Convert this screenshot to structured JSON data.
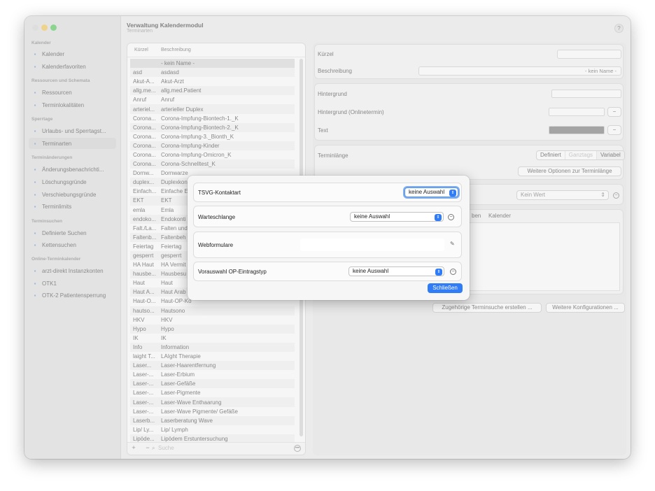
{
  "header": {
    "title": "Verwaltung Kalendermodul",
    "subtitle": "Terminarten",
    "help": "?"
  },
  "sidebar": {
    "sections": [
      {
        "title": "Kalender",
        "items": [
          "Kalender",
          "Kalenderfavoriten"
        ]
      },
      {
        "title": "Ressourcen und Schemata",
        "items": [
          "Ressourcen",
          "Terminlokalitäten"
        ]
      },
      {
        "title": "Sperrtage",
        "items": [
          "Urlaubs- und Sperrtagst...",
          "Terminarten"
        ]
      },
      {
        "title": "Terminänderungen",
        "items": [
          "Änderungsbenachrichti...",
          "Löschungsgründe",
          "Verschiebungsgründe",
          "Terminlimits"
        ]
      },
      {
        "title": "Terminsuchen",
        "items": [
          "Definierte Suchen",
          "Kettensuchen"
        ]
      },
      {
        "title": "Online-Terminkalender",
        "items": [
          "arzt-direkt Instanzkonten",
          "OTK1",
          "OTK-2 Patientensperrung"
        ]
      }
    ],
    "selected": "Terminarten"
  },
  "list": {
    "headers": {
      "kuerzel": "Kürzel",
      "beschreibung": "Beschreibung"
    },
    "rows": [
      [
        "",
        "- kein Name -"
      ],
      [
        "asd",
        "asdasd"
      ],
      [
        "Akut-A...",
        "Akut-Arzt"
      ],
      [
        "allg.me...",
        "allg.med.Patient"
      ],
      [
        "Anruf",
        "Anruf"
      ],
      [
        "arteriel...",
        "arterieller Duplex"
      ],
      [
        "Corona...",
        "Corona-Impfung-Biontech-1._K"
      ],
      [
        "Corona...",
        "Corona-Impfung-Biontech-2._K"
      ],
      [
        "Corona...",
        "Corona-Impfung-3._Bionth_K"
      ],
      [
        "Corona...",
        "Corona-Impfung-Kinder"
      ],
      [
        "Corona...",
        "Corona-Impfung-Omicron_K"
      ],
      [
        "Corona...",
        "Corona-Schnelltest_K"
      ],
      [
        "Dornw...",
        "Dornwarze"
      ],
      [
        "duplex...",
        "Duplexkon"
      ],
      [
        "Einfach...",
        "Einfache E"
      ],
      [
        "EKT",
        "EKT"
      ],
      [
        "emla",
        "Emla"
      ],
      [
        "endoko...",
        "Endokonti"
      ],
      [
        "Falt./La...",
        "Falten und"
      ],
      [
        "Faltenb...",
        "Faltenbeh"
      ],
      [
        "Feiertag",
        "Feiertag"
      ],
      [
        "gesperrt",
        "gesperrt"
      ],
      [
        "HA Haut",
        "HA Vermit"
      ],
      [
        "hausbe...",
        "Hausbesu"
      ],
      [
        "Haut",
        "Haut"
      ],
      [
        "Haut A...",
        "Haut Arab"
      ],
      [
        "Haut-O...",
        "Haut-OP-Ko"
      ],
      [
        "hautso...",
        "Hautsono"
      ],
      [
        "HKV",
        "HKV"
      ],
      [
        "Hypo",
        "Hypo"
      ],
      [
        "IK",
        "IK"
      ],
      [
        "Info",
        "Information"
      ],
      [
        "laight T...",
        "LAIght Therapie"
      ],
      [
        "Laser...",
        "Laser-Haarentfernung"
      ],
      [
        "Laser-...",
        "Laser-Erbium"
      ],
      [
        "Laser-...",
        "Laser-Gefäße"
      ],
      [
        "Laser-...",
        "Laser-Pigmente"
      ],
      [
        "Laser-...",
        "Laser-Wave Enthaarung"
      ],
      [
        "Laser-...",
        "Laser-Wave Pigmente/ Gefäße"
      ],
      [
        "Laserb...",
        "Laserberatung Wave"
      ],
      [
        "Lip/ Ly...",
        "Lip/ Lymph"
      ],
      [
        "Lipöde...",
        "Lipödem Erstuntersuchung"
      ]
    ],
    "footer": {
      "plus": "+",
      "minus": "−",
      "search_placeholder": "Suche"
    }
  },
  "detail": {
    "kuerzel_label": "Kürzel",
    "beschreibung_label": "Beschreibung",
    "beschreibung_value": "- kein Name -",
    "hintergrund_label": "Hintergrund",
    "hintergrund_online_label": "Hintergrund (Onlinetermin)",
    "text_label": "Text",
    "minus": "−",
    "terminlaenge_label": "Terminlänge",
    "terminlaenge_options": [
      "Definiert",
      "Ganztags",
      "Variabel"
    ],
    "weitere_optionen": "Weitere Optionen zur Terminlänge",
    "kein_wert": "Kein Wert",
    "tabs_partial": "ben",
    "tab_kalender": "Kalender",
    "btn_terminsuche": "Zugehörige Terminsuche erstellen ...",
    "btn_weitere_konfig": "Weitere Konfigurationen ..."
  },
  "modal": {
    "tsvg_label": "TSVG-Kontaktart",
    "tsvg_value": "keine Auswahl",
    "warteschlange_label": "Warteschlange",
    "warteschlange_value": "keine Auswahl",
    "webformulare_label": "Webformulare",
    "vorauswahl_label": "Vorauswahl OP-Eintragstyp",
    "vorauswahl_value": "keine Auswahl",
    "close_label": "Schließen"
  },
  "colors": {
    "accent": "#2f7cf6",
    "text_swatch": "#6b6b6b"
  }
}
